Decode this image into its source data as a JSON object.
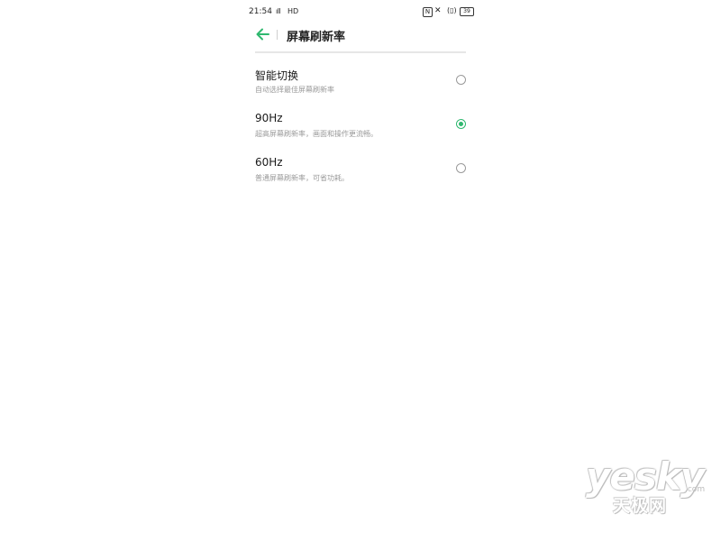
{
  "status_bar": {
    "time": "21:54",
    "signal": "ᴴᴵ",
    "network": "HD",
    "nfc": "N",
    "mute_glyph": "🔕",
    "vibrate_glyph": "(▯)",
    "battery": "39"
  },
  "header": {
    "back_icon": "arrow-left-icon",
    "title": "屏幕刷新率"
  },
  "options": [
    {
      "label": "智能切换",
      "description": "自动选择最佳屏幕刷新率",
      "selected": false
    },
    {
      "label": "90Hz",
      "description": "超高屏幕刷新率，画面和操作更流畅。",
      "selected": true
    },
    {
      "label": "60Hz",
      "description": "普通屏幕刷新率，可省功耗。",
      "selected": false
    }
  ],
  "colors": {
    "accent": "#2fb86f"
  },
  "watermark": {
    "main": "yesky",
    "domain": ".com",
    "cn": "天极网"
  }
}
